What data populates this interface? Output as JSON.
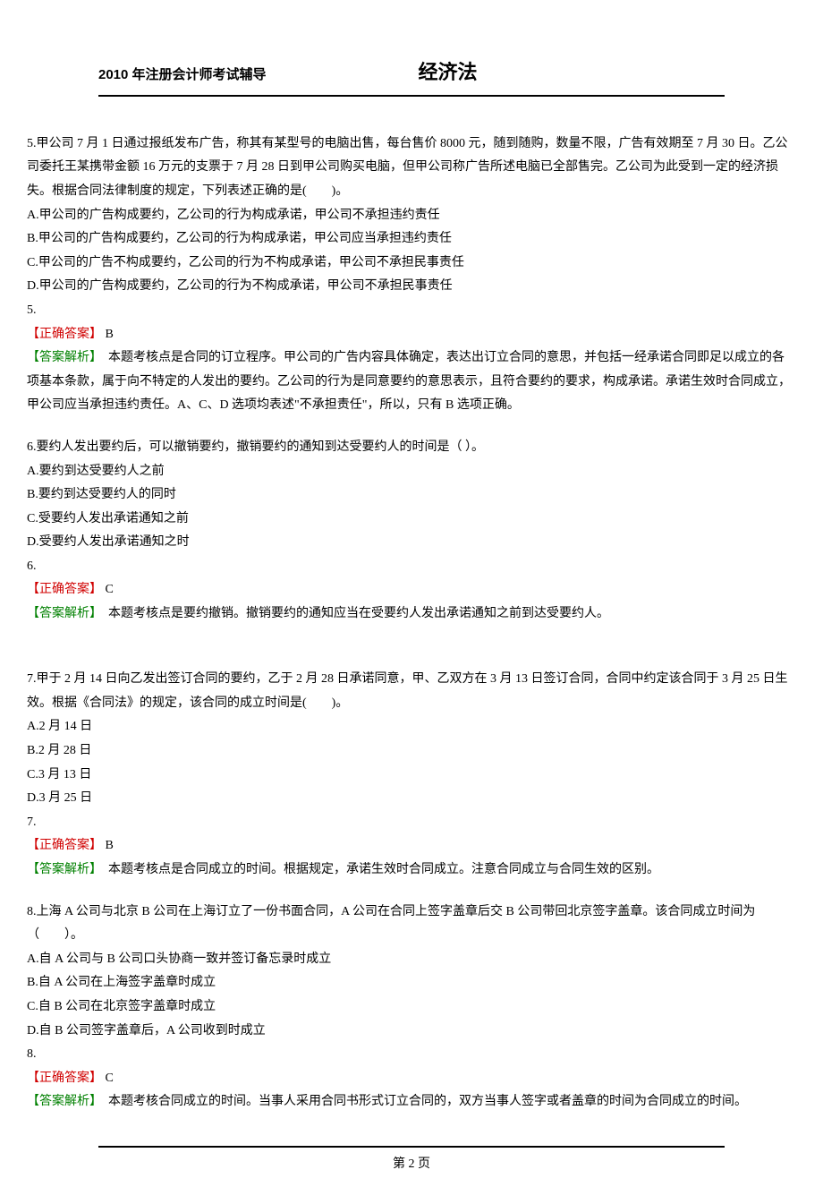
{
  "header": {
    "left": "2010 年注册会计师考试辅导",
    "title": "经济法"
  },
  "labels": {
    "correct_answer": "【正确答案】",
    "analysis": "【答案解析】"
  },
  "questions": [
    {
      "num_line": "5.",
      "stem": "甲公司 7 月 1 日通过报纸发布广告，称其有某型号的电脑出售，每台售价 8000 元，随到随购，数量不限，广告有效期至 7 月 30 日。乙公司委托王某携带金额 16 万元的支票于 7 月 28 日到甲公司购买电脑，但甲公司称广告所述电脑已全部售完。乙公司为此受到一定的经济损失。根据合同法律制度的规定，下列表述正确的是(　　)。",
      "options": [
        "A.甲公司的广告构成要约，乙公司的行为构成承诺，甲公司不承担违约责任",
        "B.甲公司的广告构成要约，乙公司的行为构成承诺，甲公司应当承担违约责任",
        "C.甲公司的广告不构成要约，乙公司的行为不构成承诺，甲公司不承担民事责任",
        "D.甲公司的广告构成要约，乙公司的行为不构成承诺，甲公司不承担民事责任"
      ],
      "after_num": "5.",
      "answer": " B",
      "analysis": "本题考核点是合同的订立程序。甲公司的广告内容具体确定，表达出订立合同的意思，并包括一经承诺合同即足以成立的各项基本条款，属于向不特定的人发出的要约。乙公司的行为是同意要约的意思表示，且符合要约的要求，构成承诺。承诺生效时合同成立，甲公司应当承担违约责任。A、C、D 选项均表述\"不承担责任\"，所以，只有 B 选项正确。"
    },
    {
      "num_line": "",
      "stem": "6.要约人发出要约后，可以撤销要约，撤销要约的通知到达受要约人的时间是（ ）。",
      "options": [
        "A.要约到达受要约人之前",
        "B.要约到达受要约人的同时",
        "C.受要约人发出承诺通知之前",
        "D.受要约人发出承诺通知之时"
      ],
      "after_num": "6.",
      "answer": " C",
      "analysis": "本题考核点是要约撤销。撤销要约的通知应当在受要约人发出承诺通知之前到达受要约人。"
    },
    {
      "num_line": "",
      "stem": "7.甲于 2 月 14 日向乙发出签订合同的要约，乙于 2 月 28 日承诺同意，甲、乙双方在 3 月 13 日签订合同，合同中约定该合同于 3 月 25 日生效。根据《合同法》的规定，该合同的成立时间是(　　)。",
      "options": [
        "A.2 月 14 日",
        "B.2 月 28 日",
        "C.3 月 13 日",
        "D.3 月 25 日"
      ],
      "after_num": "7.",
      "answer": " B",
      "analysis": "本题考核点是合同成立的时间。根据规定，承诺生效时合同成立。注意合同成立与合同生效的区别。"
    },
    {
      "num_line": "",
      "stem": "8.上海 A 公司与北京 B 公司在上海订立了一份书面合同，A 公司在合同上签字盖章后交 B 公司带回北京签字盖章。该合同成立时间为（　　）。",
      "options": [
        "A.自 A 公司与 B 公司口头协商一致并签订备忘录时成立",
        "B.自 A 公司在上海签字盖章时成立",
        "C.自 B 公司在北京签字盖章时成立",
        "D.自 B 公司签字盖章后，A 公司收到时成立"
      ],
      "after_num": "8.",
      "answer": " C",
      "analysis": "本题考核合同成立的时间。当事人采用合同书形式订立合同的，双方当事人签字或者盖章的时间为合同成立的时间。"
    }
  ],
  "footer": {
    "page": "第 2 页"
  }
}
